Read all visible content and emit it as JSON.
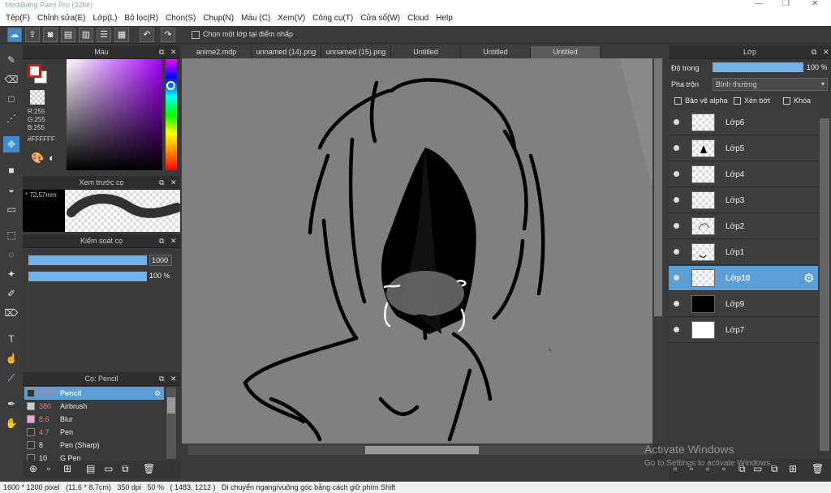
{
  "app": {
    "title": "MediBang Paint Pro (32bit)"
  },
  "menu": [
    "Tệp(F)",
    "Chỉnh sửa(E)",
    "Lớp(L)",
    "Bộ lọc(R)",
    "Chọn(S)",
    "Chụp(N)",
    "Màu (C)",
    "Xem(V)",
    "Công cụ(T)",
    "Cửa sổ(W)",
    "Cloud",
    "Help"
  ],
  "toolbar": {
    "checkbox_label": "Chọn một lớp tại điểm nhấp"
  },
  "tabs": [
    "anime2.mdp",
    "unnamed (14).png",
    "unnamed (15).png",
    "Untitled",
    "Untitled",
    "Untitled"
  ],
  "color_panel": {
    "title": "Màu",
    "r": "R:255",
    "g": "G:255",
    "b": "B:255",
    "hex": "#FFFFFF",
    "primary": "#cc1a1a",
    "secondary": "#ffffff"
  },
  "brush_preview": {
    "title": "Xem trước cọ",
    "size": "* 72.57mm"
  },
  "brush_control": {
    "title": "Kiểm soát cọ",
    "size_value": "1000",
    "opacity_value": "100 %"
  },
  "brush_list": {
    "title": "Cọ: Pencil",
    "items": [
      {
        "size": "1000",
        "name": "Pencil",
        "color": "#333333"
      },
      {
        "size": "380",
        "name": "Airbrush",
        "color": "#cccccc"
      },
      {
        "size": "8.6",
        "name": "Blur",
        "color": "#e7a6e0"
      },
      {
        "size": "4.7",
        "name": "Pen",
        "color": "#333333"
      },
      {
        "size": "8",
        "name": "Pen (Sharp)",
        "color": "#333333"
      },
      {
        "size": "10",
        "name": "G Pen",
        "color": "#333333"
      }
    ]
  },
  "layer_panel": {
    "title": "Lớp",
    "opacity_label": "Độ trong",
    "opacity_value": "100 %",
    "blend_label": "Pha trộn",
    "blend_value": "Bình thường",
    "protect_alpha": "Bảo vệ alpha",
    "clipping": "Xén bớt",
    "lock": "Khóa",
    "layers": [
      {
        "name": "Lớp6",
        "selected": false
      },
      {
        "name": "Lớp5",
        "selected": false
      },
      {
        "name": "Lớp4",
        "selected": false
      },
      {
        "name": "Lớp3",
        "selected": false
      },
      {
        "name": "Lớp2",
        "selected": false
      },
      {
        "name": "Lớp1",
        "selected": false
      },
      {
        "name": "Lớp10",
        "selected": true
      },
      {
        "name": "Lớp9",
        "selected": false
      },
      {
        "name": "Lớp7",
        "selected": false
      }
    ]
  },
  "watermark": {
    "line1": "Activate Windows",
    "line2": "Go to Settings to activate Windows."
  },
  "status": {
    "text": "1600 * 1200 pixel   (11.6 * 8.7cm)   350 dpi   50 %   ( 1483, 1212 )   Di chuyển ngang/vuông góc bằng cách giữ phím Shift"
  },
  "colors": {
    "accent": "#5b9fd6",
    "canvas_bg": "#808080"
  }
}
